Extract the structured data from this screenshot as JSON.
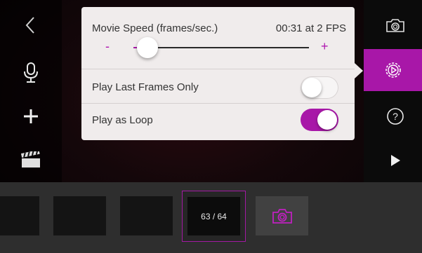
{
  "settings_panel": {
    "speed_label": "Movie Speed (frames/sec.)",
    "speed_status": "00:31 at 2 FPS",
    "minus_label": "-",
    "plus_label": "+",
    "speed_value_fraction": 0.08,
    "play_last_frames_label": "Play Last Frames Only",
    "play_last_frames_on": false,
    "loop_label": "Play as Loop",
    "loop_on": true
  },
  "left_toolbar": {
    "icons": [
      "back-icon",
      "microphone-icon",
      "add-icon",
      "clapperboard-icon"
    ]
  },
  "right_toolbar": {
    "icons": [
      "camera-icon",
      "settings-icon",
      "help-icon",
      "play-icon"
    ],
    "active": "settings-icon"
  },
  "filmstrip": {
    "frame_counter": "63 / 64"
  },
  "colors": {
    "accent": "#a817a8",
    "panel_bg": "#f0ecec",
    "toolbar_bg": "#0b0b0b",
    "strip_bg": "#2e2e2e"
  }
}
